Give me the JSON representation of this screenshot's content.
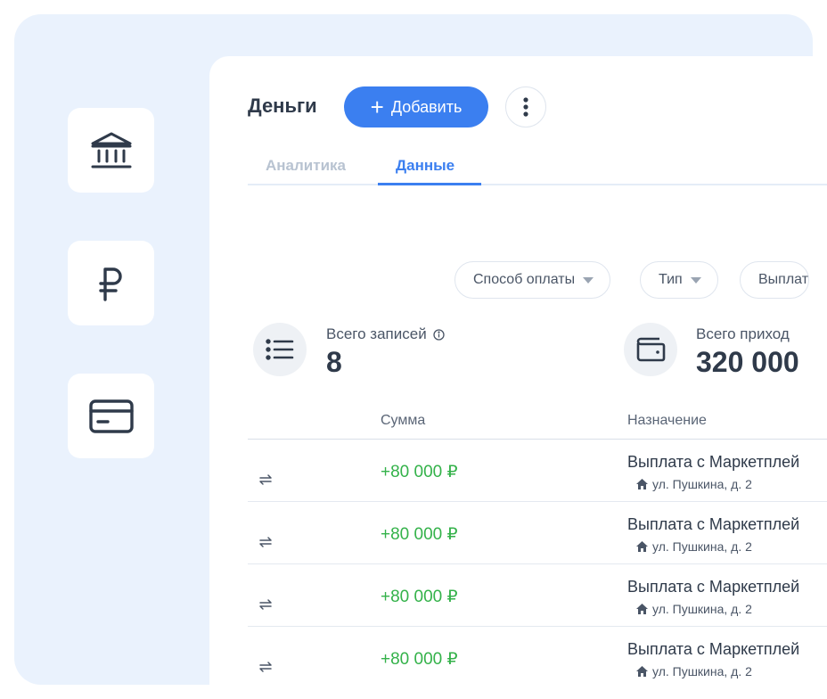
{
  "header": {
    "title": "Деньги",
    "add_label": "Добавить"
  },
  "tabs": [
    {
      "label": "Аналитика",
      "active": false
    },
    {
      "label": "Данные",
      "active": true
    }
  ],
  "filters": [
    {
      "label": "Способ оплаты"
    },
    {
      "label": "Тип"
    },
    {
      "label": "Выплат"
    }
  ],
  "stats": [
    {
      "label": "Всего записей",
      "value": "8",
      "icon": "list-icon"
    },
    {
      "label": "Всего приход",
      "value": "320 000",
      "icon": "wallet-icon"
    }
  ],
  "table": {
    "columns": [
      "Сумма",
      "Назначение"
    ],
    "rows": [
      {
        "amount": "+80 000 ₽",
        "purpose": "Выплата с Маркетплей",
        "address": "ул. Пушкина, д. 2"
      },
      {
        "amount": "+80 000 ₽",
        "purpose": "Выплата с Маркетплей",
        "address": "ул. Пушкина, д. 2"
      },
      {
        "amount": "+80 000 ₽",
        "purpose": "Выплата с Маркетплей",
        "address": "ул. Пушкина, д. 2"
      },
      {
        "amount": "+80 000 ₽",
        "purpose": "Выплата с Маркетплей",
        "address": "ул. Пушкина, д. 2"
      }
    ]
  },
  "sidebar": {
    "items": [
      {
        "icon": "bank-icon"
      },
      {
        "icon": "ruble-icon"
      },
      {
        "icon": "credit-card-icon"
      }
    ]
  },
  "colors": {
    "accent": "#3b7ff0",
    "income": "#34b24a",
    "panel_bg": "#eaf2fd"
  }
}
